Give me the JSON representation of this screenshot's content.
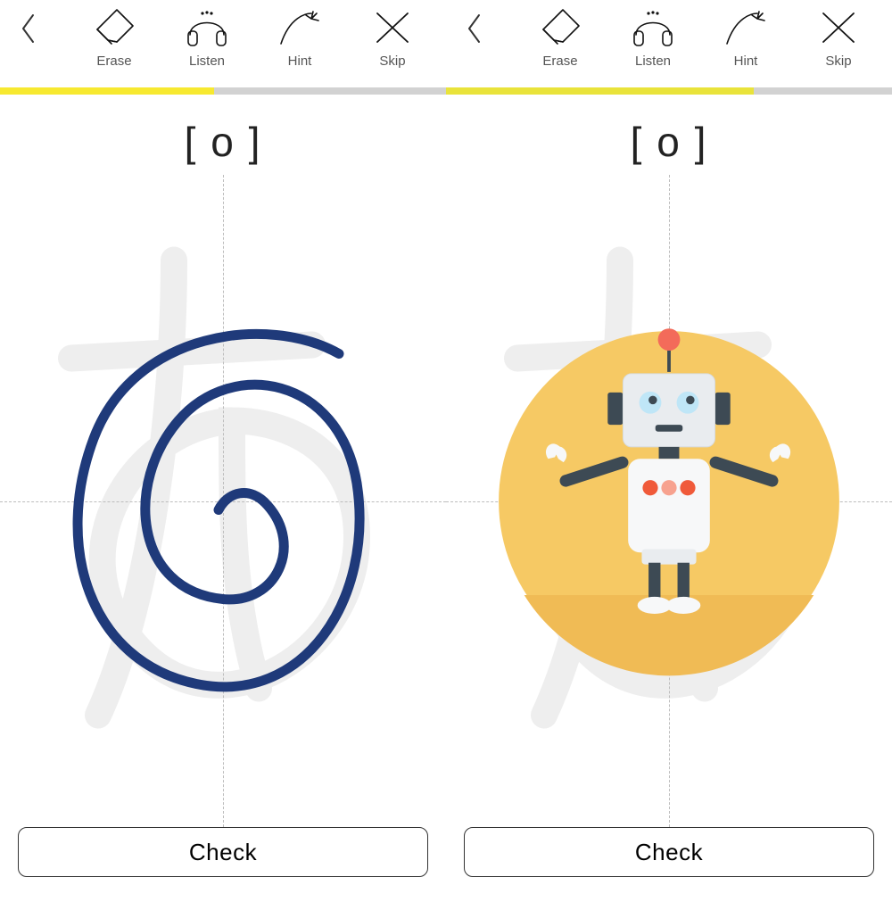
{
  "toolbar": {
    "erase_label": "Erase",
    "listen_label": "Listen",
    "hint_label": "Hint",
    "skip_label": "Skip"
  },
  "left": {
    "progress_pct": 48,
    "progress_color": "#f7e930",
    "prompt": "[ o ]",
    "ghost_character": "お",
    "stroke_color": "#1f3a7a",
    "check_label": "Check"
  },
  "right": {
    "progress_pct": 69,
    "progress_color": "#e9e33a",
    "prompt": "[ o ]",
    "ghost_character": "お",
    "illustration_name": "robot",
    "illustration_bg": "#f6c964",
    "check_label": "Check"
  }
}
